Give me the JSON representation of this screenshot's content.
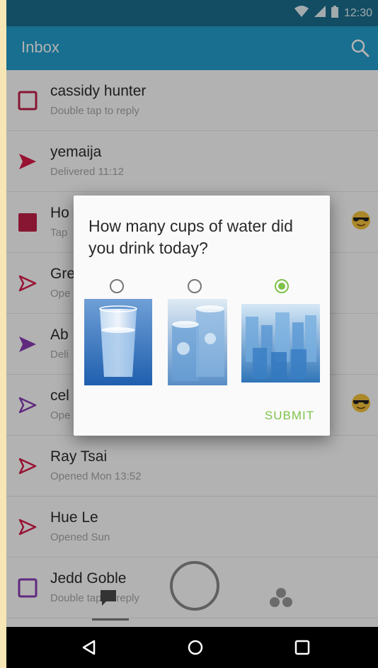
{
  "status_bar": {
    "time": "12:30",
    "wifi_icon": "wifi-icon",
    "signal_icon": "signal-icon",
    "battery_icon": "battery-icon"
  },
  "app_bar": {
    "title": "Inbox",
    "search_icon": "search-icon",
    "color": "#23a0cf"
  },
  "inbox": {
    "items": [
      {
        "name": "cassidy hunter",
        "status": "Double tap to reply",
        "icon": "square-outline-icon",
        "color": "#c2204a"
      },
      {
        "name": "yemaija",
        "status": "Delivered 11:12",
        "icon": "arrow-filled-icon",
        "color": "#d81b4a"
      },
      {
        "name": "Ho",
        "status": "Tap",
        "icon": "square-filled-icon",
        "color": "#c2204a",
        "emoji": "sunglasses-emoji-icon"
      },
      {
        "name": "Gre",
        "status": "Ope",
        "icon": "arrow-outline-icon",
        "color": "#d81b4a"
      },
      {
        "name": "Ab",
        "status": "Deli",
        "icon": "arrow-filled-icon",
        "color": "#8a3bb5"
      },
      {
        "name": "cel",
        "status": "Ope",
        "icon": "arrow-outline-icon",
        "color": "#8a3bb5",
        "emoji": "sunglasses-emoji-icon"
      },
      {
        "name": "Ray Tsai",
        "status": "Opened Mon 13:52",
        "icon": "arrow-outline-icon",
        "color": "#d81b4a"
      },
      {
        "name": "Hue Le",
        "status": "Opened Sun",
        "icon": "arrow-outline-icon",
        "color": "#d81b4a"
      },
      {
        "name": "Jedd Goble",
        "status": "Double tap to reply",
        "icon": "square-outline-icon",
        "color": "#8a3bb5"
      }
    ]
  },
  "bottom_nav": {
    "chat_icon": "chat-icon",
    "capture_icon": "capture-button-icon",
    "stories_icon": "stories-icon"
  },
  "dialog": {
    "question": "How many cups of water did you drink today?",
    "options": [
      {
        "image": "one-glass-image",
        "selected": false
      },
      {
        "image": "two-glasses-image",
        "selected": false
      },
      {
        "image": "many-glasses-image",
        "selected": true
      }
    ],
    "submit_label": "SUBMIT",
    "accent": "#7ec24a"
  },
  "nav_bar": {
    "back_icon": "back-icon",
    "home_icon": "home-icon",
    "recents_icon": "recents-icon"
  }
}
